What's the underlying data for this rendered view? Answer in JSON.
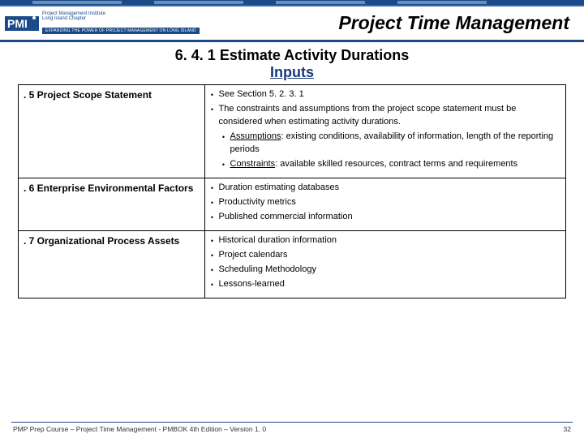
{
  "header": {
    "logo": {
      "line1": "Project Management Institute",
      "line2": "Long Island Chapter",
      "strip": "EXPANDING THE POWER OF PROJECT MANAGEMENT ON LONG ISLAND"
    },
    "title": "Project Time Management"
  },
  "section": {
    "number_title": "6. 4. 1 Estimate Activity Durations",
    "subtitle": "Inputs"
  },
  "rows": [
    {
      "label": ". 5  Project Scope Statement",
      "items": [
        {
          "type": "plain",
          "text": "See Section 5. 2. 3. 1"
        },
        {
          "type": "plain",
          "text": "The constraints and assumptions from the project scope statement must be considered when estimating activity durations."
        },
        {
          "type": "indent",
          "strong": "Assumptions",
          "rest": ": existing conditions, availability of information, length of the reporting periods"
        },
        {
          "type": "indent",
          "strong": "Constraints",
          "rest": ": available skilled resources, contract terms and requirements"
        }
      ]
    },
    {
      "label": ". 6 Enterprise Environmental Factors",
      "items": [
        {
          "type": "plain",
          "text": "Duration estimating databases"
        },
        {
          "type": "plain",
          "text": "Productivity metrics"
        },
        {
          "type": "plain",
          "text": "Published commercial information"
        }
      ]
    },
    {
      "label": ". 7 Organizational Process Assets",
      "items": [
        {
          "type": "plain",
          "text": "Historical duration information"
        },
        {
          "type": "plain",
          "text": "Project calendars"
        },
        {
          "type": "plain",
          "text": "Scheduling Methodology"
        },
        {
          "type": "plain",
          "text": "Lessons-learned"
        }
      ]
    }
  ],
  "footer": {
    "left": "PMP Prep Course – Project Time Management - PMBOK 4th Edition – Version 1. 0",
    "page": "32"
  }
}
